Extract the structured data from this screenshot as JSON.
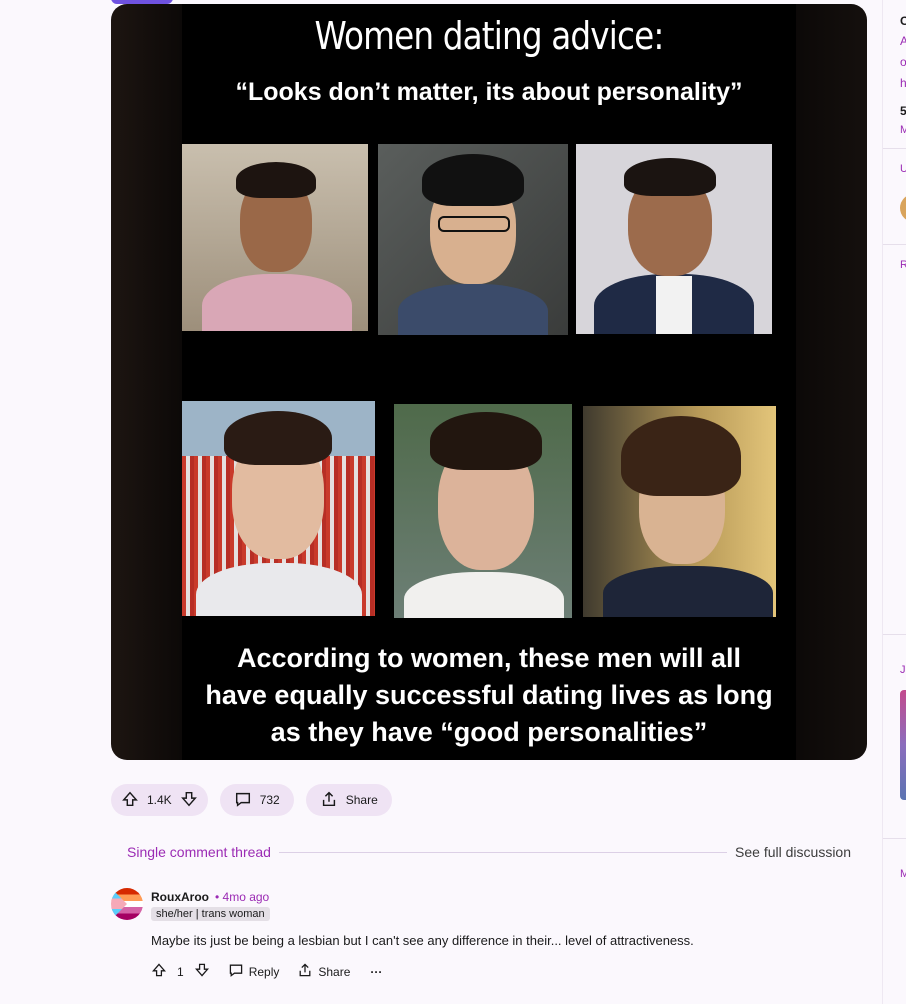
{
  "post": {
    "image": {
      "title": "Women dating advice:",
      "quote": "“Looks don’t matter, its about personality”",
      "caption_lines": [
        "According to women, these men will all",
        "have equally successful dating lives as long",
        "as they have “good personalities”"
      ]
    },
    "actions": {
      "upvotes": "1.4K",
      "comments": "732",
      "share_label": "Share"
    }
  },
  "thread": {
    "single_label": "Single comment thread",
    "full_label": "See full discussion"
  },
  "comment": {
    "author": "RouxAroo",
    "time": "• 4mo ago",
    "flair": "she/her | trans woman",
    "body": "Maybe its just be being a lesbian but I can't see any difference in their... level of attractiveness.",
    "score": "1",
    "reply_label": "Reply",
    "share_label": "Share",
    "more_label": "···"
  },
  "sidebar": {
    "fragments": [
      "C",
      "A",
      "o",
      "h",
      "5",
      "M",
      "U",
      "R",
      "J",
      "M"
    ]
  },
  "colors": {
    "accent": "#9b2bb4",
    "pill_bg": "#efe3f4",
    "page_bg": "#fbf8fd"
  },
  "icons": [
    "upvote-icon",
    "downvote-icon",
    "comment-icon",
    "share-icon",
    "more-icon"
  ]
}
